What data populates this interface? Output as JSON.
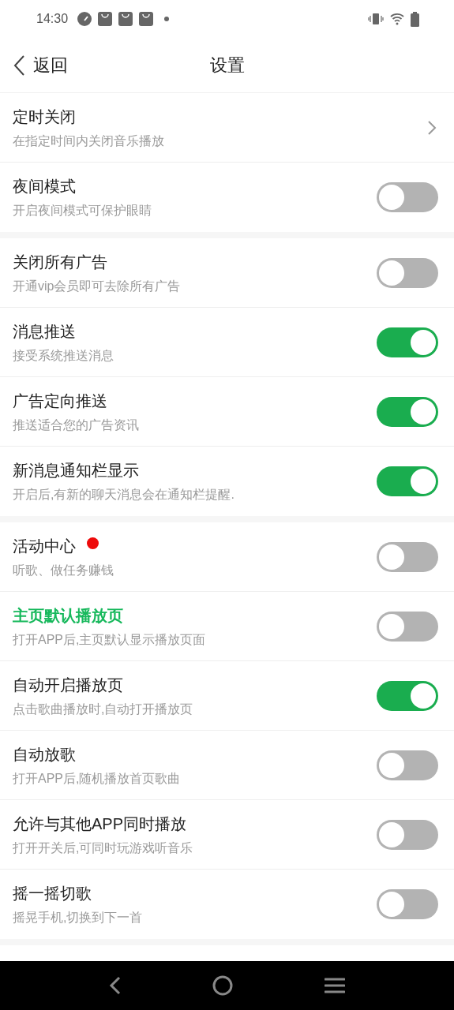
{
  "status_bar": {
    "time": "14:30"
  },
  "header": {
    "back_label": "返回",
    "title": "设置"
  },
  "sections": [
    {
      "rows": [
        {
          "kind": "chevron",
          "title": "定时关闭",
          "subtitle": "在指定时间内关闭音乐播放",
          "highlighted": false,
          "badge": false
        },
        {
          "kind": "toggle",
          "title": "夜间模式",
          "subtitle": "开启夜间模式可保护眼睛",
          "on": false,
          "highlighted": false,
          "badge": false
        }
      ]
    },
    {
      "rows": [
        {
          "kind": "toggle",
          "title": "关闭所有广告",
          "subtitle": "开通vip会员即可去除所有广告",
          "on": false,
          "highlighted": false,
          "badge": false
        },
        {
          "kind": "toggle",
          "title": "消息推送",
          "subtitle": "接受系统推送消息",
          "on": true,
          "highlighted": false,
          "badge": false
        },
        {
          "kind": "toggle",
          "title": "广告定向推送",
          "subtitle": "推送适合您的广告资讯",
          "on": true,
          "highlighted": false,
          "badge": false
        },
        {
          "kind": "toggle",
          "title": "新消息通知栏显示",
          "subtitle": "开启后,有新的聊天消息会在通知栏提醒.",
          "on": true,
          "highlighted": false,
          "badge": false
        }
      ]
    },
    {
      "rows": [
        {
          "kind": "toggle",
          "title": "活动中心",
          "subtitle": "听歌、做任务赚钱",
          "on": false,
          "highlighted": false,
          "badge": true
        },
        {
          "kind": "toggle",
          "title": "主页默认播放页",
          "subtitle": "打开APP后,主页默认显示播放页面",
          "on": false,
          "highlighted": true,
          "badge": false
        },
        {
          "kind": "toggle",
          "title": "自动开启播放页",
          "subtitle": "点击歌曲播放时,自动打开播放页",
          "on": true,
          "highlighted": false,
          "badge": false
        },
        {
          "kind": "toggle",
          "title": "自动放歌",
          "subtitle": "打开APP后,随机播放首页歌曲",
          "on": false,
          "highlighted": false,
          "badge": false
        },
        {
          "kind": "toggle",
          "title": "允许与其他APP同时播放",
          "subtitle": "打开开关后,可同时玩游戏听音乐",
          "on": false,
          "highlighted": false,
          "badge": false
        },
        {
          "kind": "toggle",
          "title": "摇一摇切歌",
          "subtitle": "摇晃手机,切换到下一首",
          "on": false,
          "highlighted": false,
          "badge": false
        }
      ]
    }
  ]
}
